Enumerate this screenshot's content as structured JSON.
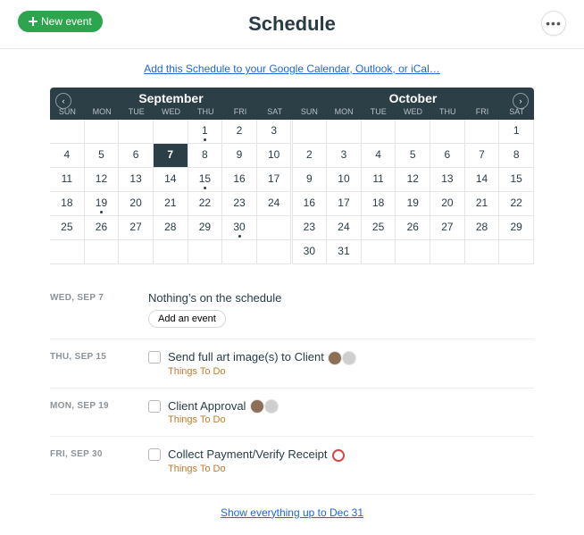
{
  "header": {
    "title": "Schedule",
    "new_event": "New event"
  },
  "subscribe_link": "Add this Schedule to your Google Calendar, Outlook, or iCal…",
  "months": [
    {
      "name": "September",
      "dow": [
        "SUN",
        "MON",
        "TUE",
        "WED",
        "THU",
        "FRI",
        "SAT"
      ],
      "weeks": [
        [
          {
            "d": "",
            "empty": true
          },
          {
            "d": "",
            "empty": true
          },
          {
            "d": "",
            "empty": true
          },
          {
            "d": "",
            "empty": true
          },
          {
            "d": "1",
            "dot": true
          },
          {
            "d": "2"
          },
          {
            "d": "3"
          }
        ],
        [
          {
            "d": "4"
          },
          {
            "d": "5"
          },
          {
            "d": "6"
          },
          {
            "d": "7",
            "sel": true
          },
          {
            "d": "8"
          },
          {
            "d": "9"
          },
          {
            "d": "10"
          }
        ],
        [
          {
            "d": "11"
          },
          {
            "d": "12"
          },
          {
            "d": "13"
          },
          {
            "d": "14"
          },
          {
            "d": "15",
            "dot": true
          },
          {
            "d": "16"
          },
          {
            "d": "17"
          }
        ],
        [
          {
            "d": "18"
          },
          {
            "d": "19",
            "dot": true
          },
          {
            "d": "20"
          },
          {
            "d": "21"
          },
          {
            "d": "22"
          },
          {
            "d": "23"
          },
          {
            "d": "24"
          }
        ],
        [
          {
            "d": "25"
          },
          {
            "d": "26"
          },
          {
            "d": "27"
          },
          {
            "d": "28"
          },
          {
            "d": "29"
          },
          {
            "d": "30",
            "dot": true
          },
          {
            "d": "",
            "empty": true
          }
        ],
        [
          {
            "d": "",
            "empty": true
          },
          {
            "d": "",
            "empty": true
          },
          {
            "d": "",
            "empty": true
          },
          {
            "d": "",
            "empty": true
          },
          {
            "d": "",
            "empty": true
          },
          {
            "d": "",
            "empty": true
          },
          {
            "d": "",
            "empty": true
          }
        ]
      ]
    },
    {
      "name": "October",
      "dow": [
        "SUN",
        "MON",
        "TUE",
        "WED",
        "THU",
        "FRI",
        "SAT"
      ],
      "weeks": [
        [
          {
            "d": "",
            "empty": true
          },
          {
            "d": "",
            "empty": true
          },
          {
            "d": "",
            "empty": true
          },
          {
            "d": "",
            "empty": true
          },
          {
            "d": "",
            "empty": true
          },
          {
            "d": "",
            "empty": true
          },
          {
            "d": "1"
          }
        ],
        [
          {
            "d": "2"
          },
          {
            "d": "3"
          },
          {
            "d": "4"
          },
          {
            "d": "5"
          },
          {
            "d": "6"
          },
          {
            "d": "7"
          },
          {
            "d": "8"
          }
        ],
        [
          {
            "d": "9"
          },
          {
            "d": "10"
          },
          {
            "d": "11"
          },
          {
            "d": "12"
          },
          {
            "d": "13"
          },
          {
            "d": "14"
          },
          {
            "d": "15"
          }
        ],
        [
          {
            "d": "16"
          },
          {
            "d": "17"
          },
          {
            "d": "18"
          },
          {
            "d": "19"
          },
          {
            "d": "20"
          },
          {
            "d": "21"
          },
          {
            "d": "22"
          }
        ],
        [
          {
            "d": "23"
          },
          {
            "d": "24"
          },
          {
            "d": "25"
          },
          {
            "d": "26"
          },
          {
            "d": "27"
          },
          {
            "d": "28"
          },
          {
            "d": "29"
          }
        ],
        [
          {
            "d": "30"
          },
          {
            "d": "31"
          },
          {
            "d": "",
            "empty": true
          },
          {
            "d": "",
            "empty": true
          },
          {
            "d": "",
            "empty": true
          },
          {
            "d": "",
            "empty": true
          },
          {
            "d": "",
            "empty": true
          }
        ]
      ]
    }
  ],
  "agenda": [
    {
      "date": "WED, SEP 7",
      "empty_text": "Nothing’s on the schedule",
      "add_label": "Add an event"
    },
    {
      "date": "THU, SEP 15",
      "title": "Send full art image(s) to Client",
      "avatars": [
        "brown",
        "gray"
      ],
      "list": "Things To Do"
    },
    {
      "date": "MON, SEP 19",
      "title": "Client Approval",
      "avatars": [
        "brown",
        "gray"
      ],
      "list": "Things To Do"
    },
    {
      "date": "FRI, SEP 30",
      "title": "Collect Payment/Verify Receipt",
      "avatars": [
        "red"
      ],
      "list": "Things To Do"
    }
  ],
  "footer_link": "Show everything up to Dec 31"
}
